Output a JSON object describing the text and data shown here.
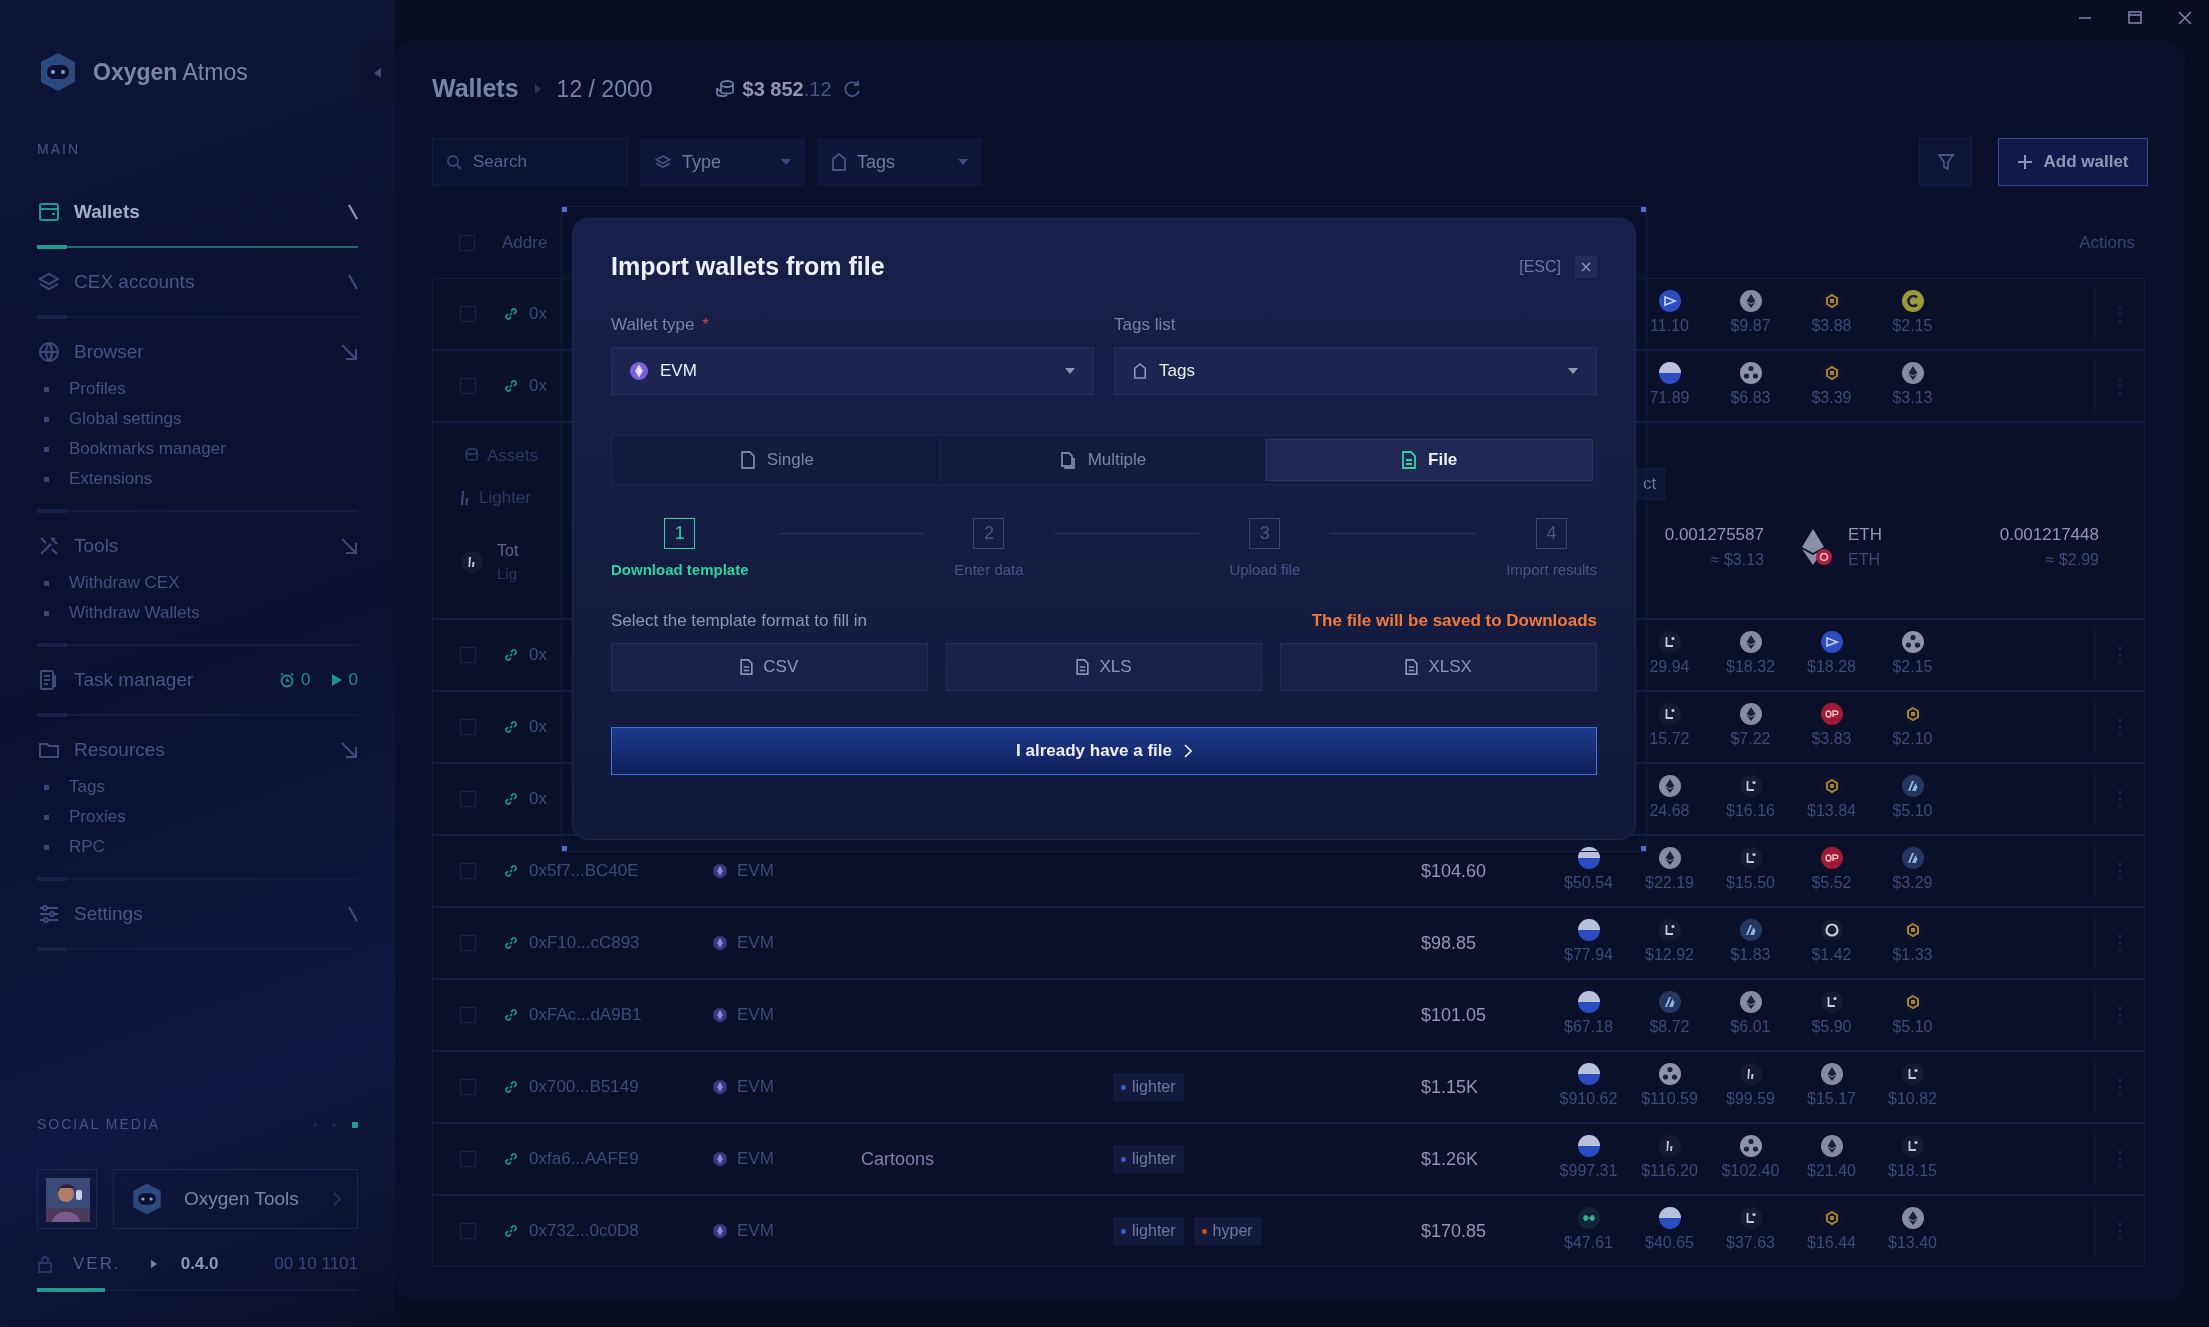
{
  "sidebar": {
    "brand_bold": "Oxygen",
    "brand_light": "Atmos",
    "section": "MAIN",
    "groups": [
      {
        "kind": "wallet",
        "label": "Wallets",
        "selected": true,
        "expanded": false
      },
      {
        "kind": "layers",
        "label": "CEX accounts",
        "selected": false,
        "expanded": false
      },
      {
        "kind": "globe",
        "label": "Browser",
        "selected": false,
        "expanded": true,
        "children": [
          "Profiles",
          "Global settings",
          "Bookmarks manager",
          "Extensions"
        ]
      },
      {
        "kind": "tools",
        "label": "Tools",
        "selected": false,
        "expanded": true,
        "children": [
          "Withdraw CEX",
          "Withdraw Wallets"
        ]
      },
      {
        "kind": "tasks",
        "label": "Task manager",
        "selected": false,
        "counters": [
          "0",
          "0"
        ]
      },
      {
        "kind": "folder",
        "label": "Resources",
        "selected": false,
        "expanded": true,
        "children": [
          "Tags",
          "Proxies",
          "RPC"
        ]
      },
      {
        "kind": "sliders",
        "label": "Settings",
        "selected": false,
        "expanded": false
      }
    ],
    "social_title": "SOCIAL MEDIA",
    "social_card": "Oxygen Tools",
    "version": {
      "label": "VER.",
      "value": "0.4.0",
      "code": "00 10 1101"
    }
  },
  "header": {
    "title": "Wallets",
    "count": "12 / 2000",
    "balance_whole": "$3 852",
    "balance_fraction": ".12"
  },
  "toolbar": {
    "search_placeholder": "Search",
    "filters": [
      "Type",
      "Tags"
    ],
    "add_button": "Add wallet"
  },
  "table": {
    "select_all_checked": false,
    "header_address": "Addre",
    "header_actions": "Actions",
    "rows": [
      {
        "kind": "wallet",
        "address": "0x",
        "checked": false,
        "tokens": [
          {
            "kind": "blue",
            "value": "11.10"
          },
          {
            "kind": "eth",
            "value": "$9.87"
          },
          {
            "kind": "bnb",
            "value": "$3.88"
          },
          {
            "kind": "celo",
            "value": "$2.15"
          }
        ]
      },
      {
        "kind": "wallet",
        "address": "0x",
        "checked": false,
        "tokens": [
          {
            "kind": "half",
            "value": "71.89"
          },
          {
            "kind": "pinwheel",
            "value": "$6.83"
          },
          {
            "kind": "bnb",
            "value": "$3.39"
          },
          {
            "kind": "eth",
            "value": "$3.13"
          }
        ]
      },
      {
        "kind": "details",
        "section": "Assets",
        "subsection": "Lighter",
        "summary_title": "Tot",
        "summary_sub": "Lig",
        "button": "ct",
        "balance": {
          "amount": "0.001275587",
          "usd": "≈ $3.13"
        },
        "token": {
          "symbol": "ETH",
          "network": "ETH"
        },
        "value": {
          "amount": "0.001217448",
          "usd": "≈ $2.99"
        }
      },
      {
        "kind": "wallet",
        "address": "0x",
        "checked": false,
        "tokens": [
          {
            "kind": "scroll",
            "value": "29.94"
          },
          {
            "kind": "eth",
            "value": "$18.32"
          },
          {
            "kind": "blue",
            "value": "$18.28"
          },
          {
            "kind": "pinwheel",
            "value": "$2.15"
          }
        ]
      },
      {
        "kind": "wallet",
        "address": "0x",
        "checked": false,
        "tokens": [
          {
            "kind": "scroll",
            "value": "15.72"
          },
          {
            "kind": "eth",
            "value": "$7.22"
          },
          {
            "kind": "op",
            "value": "$3.83"
          },
          {
            "kind": "bnb",
            "value": "$2.10"
          }
        ]
      },
      {
        "kind": "wallet",
        "address": "0x",
        "checked": false,
        "tokens": [
          {
            "kind": "eth",
            "value": "24.68"
          },
          {
            "kind": "scroll",
            "value": "$16.16"
          },
          {
            "kind": "bnb",
            "value": "$13.84"
          },
          {
            "kind": "arb",
            "value": "$5.10"
          }
        ]
      },
      {
        "kind": "wallet",
        "address": "0x5f7...BC40E",
        "type": "EVM",
        "total": "$104.60",
        "checked": false,
        "tokens": [
          {
            "kind": "half",
            "value": "$50.54"
          },
          {
            "kind": "eth",
            "value": "$22.19"
          },
          {
            "kind": "scroll",
            "value": "$15.50"
          },
          {
            "kind": "op",
            "value": "$5.52"
          },
          {
            "kind": "arb",
            "value": "$3.29"
          }
        ]
      },
      {
        "kind": "wallet",
        "address": "0xF10...cC893",
        "type": "EVM",
        "total": "$98.85",
        "checked": false,
        "tokens": [
          {
            "kind": "half",
            "value": "$77.94"
          },
          {
            "kind": "scroll",
            "value": "$12.92"
          },
          {
            "kind": "arb",
            "value": "$1.83"
          },
          {
            "kind": "ring",
            "value": "$1.42"
          },
          {
            "kind": "bnb",
            "value": "$1.33"
          }
        ]
      },
      {
        "kind": "wallet",
        "address": "0xFAc...dA9B1",
        "type": "EVM",
        "total": "$101.05",
        "checked": false,
        "tokens": [
          {
            "kind": "half",
            "value": "$67.18"
          },
          {
            "kind": "arb",
            "value": "$8.72"
          },
          {
            "kind": "eth",
            "value": "$6.01"
          },
          {
            "kind": "scroll",
            "value": "$5.90"
          },
          {
            "kind": "bnb",
            "value": "$5.10"
          }
        ]
      },
      {
        "kind": "wallet",
        "address": "0x700...B5149",
        "type": "EVM",
        "tags": [
          {
            "label": "lighter",
            "color": "#3b5bdb"
          }
        ],
        "total": "$1.15K",
        "checked": false,
        "tokens": [
          {
            "kind": "half",
            "value": "$910.62"
          },
          {
            "kind": "pinwheel",
            "value": "$110.59"
          },
          {
            "kind": "lighter",
            "value": "$99.59"
          },
          {
            "kind": "eth",
            "value": "$15.17"
          },
          {
            "kind": "scroll",
            "value": "$10.82"
          }
        ]
      },
      {
        "kind": "wallet",
        "address": "0xfa6...AAFE9",
        "type": "EVM",
        "name": "Cartoons",
        "tags": [
          {
            "label": "lighter",
            "color": "#3b5bdb"
          }
        ],
        "total": "$1.26K",
        "checked": false,
        "tokens": [
          {
            "kind": "half",
            "value": "$997.31"
          },
          {
            "kind": "lighter",
            "value": "$116.20"
          },
          {
            "kind": "pinwheel",
            "value": "$102.40"
          },
          {
            "kind": "eth",
            "value": "$21.40"
          },
          {
            "kind": "scroll",
            "value": "$18.15"
          }
        ]
      },
      {
        "kind": "wallet",
        "address": "0x732...0c0D8",
        "type": "EVM",
        "tags": [
          {
            "label": "lighter",
            "color": "#3b5bdb"
          },
          {
            "label": "hyper",
            "color": "#c2571c"
          }
        ],
        "total": "$170.85",
        "checked": false,
        "tokens": [
          {
            "kind": "hyper",
            "value": "$47.61"
          },
          {
            "kind": "half",
            "value": "$40.65"
          },
          {
            "kind": "scroll",
            "value": "$37.63"
          },
          {
            "kind": "bnb",
            "value": "$16.44"
          },
          {
            "kind": "eth",
            "value": "$13.40"
          }
        ]
      }
    ]
  },
  "modal": {
    "title": "Import wallets from file",
    "esc": "[ESC]",
    "wallet_type": {
      "label": "Wallet type",
      "required": "*",
      "value": "EVM"
    },
    "tags_list": {
      "label": "Tags list",
      "value": "Tags"
    },
    "modes": [
      {
        "label": "Single",
        "selected": false
      },
      {
        "label": "Multiple",
        "selected": false
      },
      {
        "label": "File",
        "selected": true
      }
    ],
    "steps": [
      {
        "number": "1",
        "label": "Download template",
        "selected": true
      },
      {
        "number": "2",
        "label": "Enter data",
        "selected": false
      },
      {
        "number": "3",
        "label": "Upload file",
        "selected": false
      },
      {
        "number": "4",
        "label": "Import results",
        "selected": false
      }
    ],
    "format_prompt": "Select the template format to fill in",
    "save_note": "The file will be saved to Downloads",
    "formats": [
      "CSV",
      "XLS",
      "XLSX"
    ],
    "primary_button": "I already have a file"
  }
}
